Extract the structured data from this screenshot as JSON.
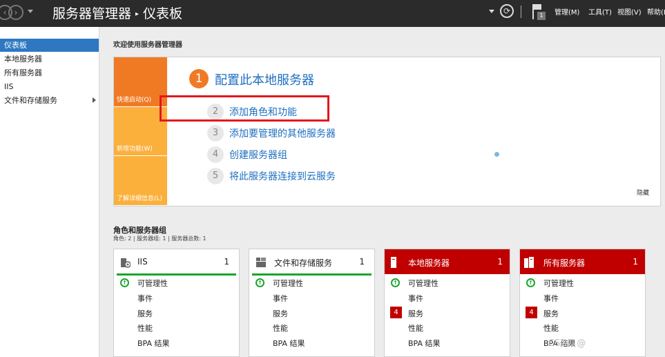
{
  "header": {
    "app_title": "服务器管理器",
    "separator": "▸",
    "page": "仪表板",
    "flag_count": "1",
    "menus": [
      "管理(M)",
      "工具(T)",
      "视图(V)",
      "帮助(H"
    ]
  },
  "sidebar": {
    "items": [
      {
        "label": "仪表板",
        "active": true
      },
      {
        "label": "本地服务器"
      },
      {
        "label": "所有服务器"
      },
      {
        "label": "IIS"
      },
      {
        "label": "文件和存储服务",
        "has_submenu": true
      }
    ]
  },
  "welcome": {
    "title": "欢迎使用服务器管理器",
    "tabs": [
      "快速启动(Q)",
      "新增功能(W)",
      "了解详细信息(L)"
    ],
    "steps": [
      {
        "num": "1",
        "label": "配置此本地服务器"
      },
      {
        "num": "2",
        "label": "添加角色和功能"
      },
      {
        "num": "3",
        "label": "添加要管理的其他服务器"
      },
      {
        "num": "4",
        "label": "创建服务器组"
      },
      {
        "num": "5",
        "label": "将此服务器连接到云服务"
      }
    ],
    "hide": "隐藏"
  },
  "roles": {
    "title": "角色和服务器组",
    "subtitle": "角色: 2 | 服务器组: 1 | 服务器总数: 1",
    "tiles": [
      {
        "name": "IIS",
        "count": "1",
        "alert": false,
        "rows": [
          "可管理性",
          "事件",
          "服务",
          "性能",
          "BPA 结果"
        ],
        "service_badge": ""
      },
      {
        "name": "文件和存储服务",
        "count": "1",
        "alert": false,
        "rows": [
          "可管理性",
          "事件",
          "服务",
          "性能",
          "BPA 结果"
        ],
        "service_badge": ""
      },
      {
        "name": "本地服务器",
        "count": "1",
        "alert": true,
        "rows": [
          "可管理性",
          "事件",
          "服务",
          "性能",
          "BPA 结果"
        ],
        "service_badge": "4"
      },
      {
        "name": "所有服务器",
        "count": "1",
        "alert": true,
        "rows": [
          "可管理性",
          "事件",
          "服务",
          "性能",
          "BPA 结果"
        ],
        "service_badge": "4"
      }
    ]
  },
  "colors": {
    "accent": "#1e6fc0",
    "alert": "#c00000",
    "ok": "#1aa52b",
    "quickstart": "#f07a24"
  },
  "watermark": "CSDN @"
}
